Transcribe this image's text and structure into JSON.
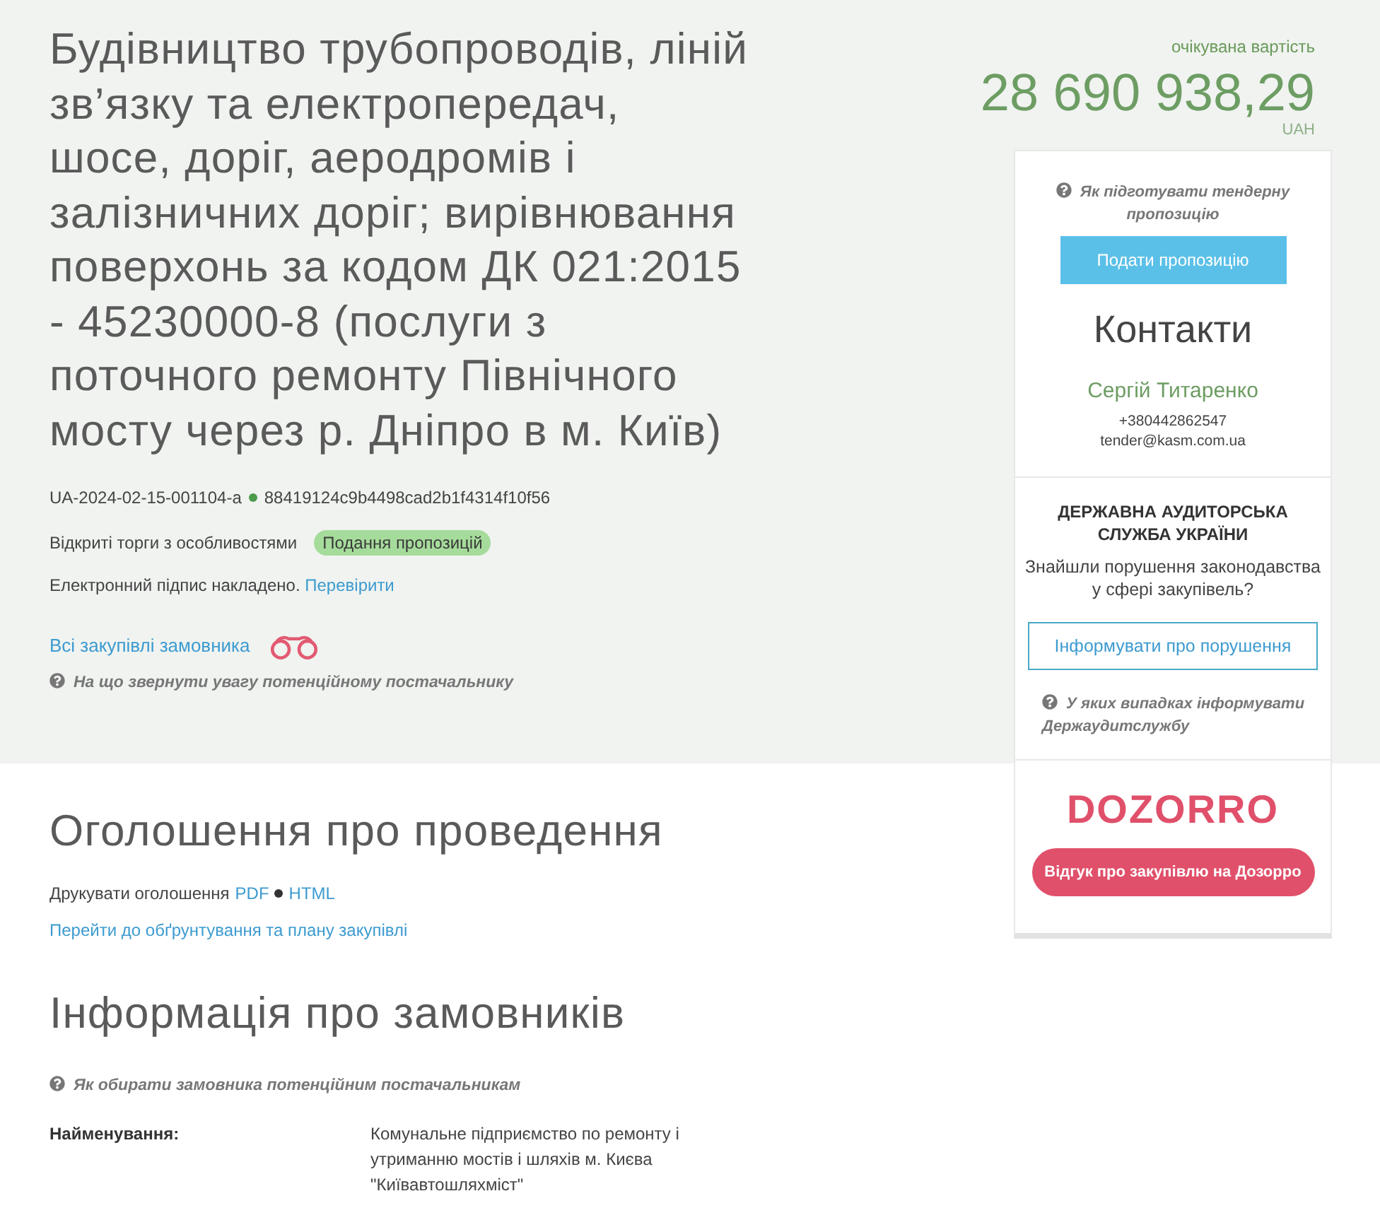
{
  "tender": {
    "title": "Будівництво трубопроводів, ліній зв’язку та електропередач, шосе, доріг, аеродромів і залізничних доріг; вирівнювання поверхонь за кодом ДК 021:2015 - 45230000-8 (послуги з поточного ремонту Північного мосту через р. Дніпро в м. Київ)",
    "id": "UA-2024-02-15-001104-a",
    "hash": "88419124c9b4498cad2b1f4314f10f56",
    "procedure": "Відкриті торги з особливостями",
    "status": "Подання пропозицій",
    "signature": {
      "text": "Електронний підпис накладено.",
      "link": "Перевірити"
    },
    "buyer_link": "Всі закупівлі замовника",
    "hint": "На що звернути увагу потенційному постачальнику"
  },
  "value": {
    "caption": "очікувана вартість",
    "amount": "28 690 938,29",
    "currency": "UAH"
  },
  "sidebar": {
    "hint": "Як підготувати тендерну пропозицію",
    "submit_button": "Подати пропозицію",
    "contacts_title": "Контакти",
    "contact_name": "Сергій Титаренко",
    "phone": "+380442862547",
    "email": "tender@kasm.com.ua",
    "audit": {
      "title": "ДЕРЖАВНА АУДИТОРСЬКА СЛУЖБА УКРАЇНИ",
      "question": "Знайшли порушення законодавства у сфері закупівель?",
      "button": "Інформувати про порушення",
      "hint": "У яких випадках інформувати Держаудитслужбу"
    },
    "dozorro": {
      "logo": "DOZORRO",
      "button": "Відгук про закупівлю на Дозорро"
    }
  },
  "announcement": {
    "title": "Оголошення про проведення",
    "print_label": "Друкувати оголошення",
    "print_links": [
      "PDF",
      "HTML"
    ],
    "plan_link": "Перейти до обґрунтування та плану закупівлі"
  },
  "buyers": {
    "title": "Інформація про замовників",
    "hint": "Як обирати замовника потенційним постачальникам",
    "fields": [
      {
        "label": "Найменування:",
        "value": "Комунальне підприємство по ремонту і утриманню мостів і шляхів м. Києва \"Київавтошляхміст\""
      }
    ]
  }
}
